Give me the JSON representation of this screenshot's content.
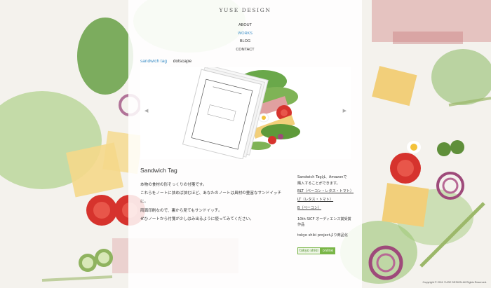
{
  "site": {
    "logo": "YUSE DESIGN"
  },
  "nav": {
    "items": [
      {
        "label": "ABOUT",
        "active": false
      },
      {
        "label": "WORKS",
        "active": true
      },
      {
        "label": "BLOG",
        "active": false
      },
      {
        "label": "CONTACT",
        "active": false
      }
    ]
  },
  "tabs": [
    {
      "label": "sandwich tag",
      "active": true
    },
    {
      "label": "dotscape",
      "active": false
    }
  ],
  "slider": {
    "prev_icon": "◀",
    "next_icon": "▶"
  },
  "work": {
    "title": "Sandwich Tag",
    "description": [
      "本物の食材の形そっくりの付箋です。",
      "これらをノートに挟めば挟むほど、あなたのノートは具材の豊富なサンドイッチに。",
      "両面印刷なので、裏から見てもサンドイッチ。",
      "ぜひノートから付箋が少しはみ出るように使ってみてください。"
    ]
  },
  "side": {
    "amazon_line1": "Sandwich Tagは、Amazonで",
    "amazon_line2": "購入することができます。",
    "links": [
      "BLT（ベーコン・レタス・トマト）",
      "LT（レタス・トマト）",
      "B（ベーコン）"
    ],
    "award_line1": "10th SICF オーディエンス賞受賞",
    "award_line2": "作品",
    "product": "tokyo shiki projectより商品化",
    "badge1": "tokyo shiki",
    "badge2": "online"
  },
  "footer": {
    "copyright": "Copyright © 2011 YUSE DESIGN All Rights Reserved."
  },
  "colors": {
    "accent": "#3d8fc7",
    "badge_green": "#7ab648"
  }
}
